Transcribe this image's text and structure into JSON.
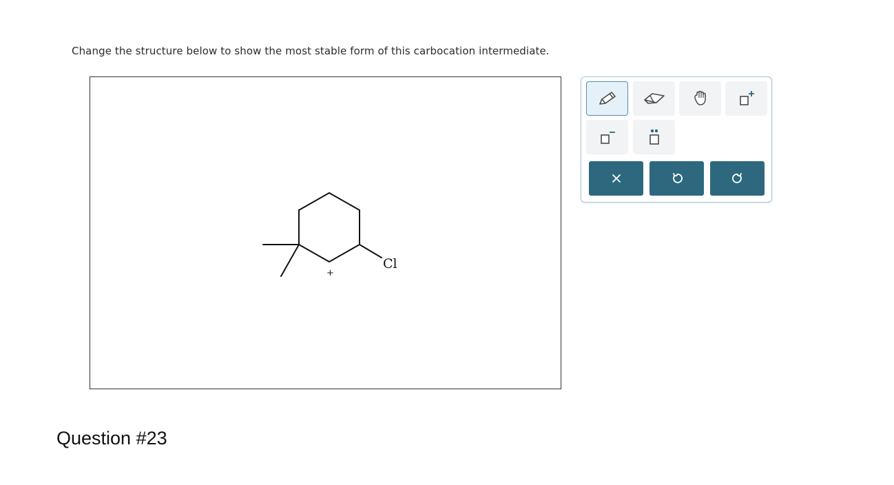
{
  "instruction": "Change the structure below to show the most stable form of this carbocation intermediate.",
  "molecule": {
    "charge_label": "+",
    "substituent_label": "Cl"
  },
  "toolbar": {
    "tools": [
      {
        "name": "pencil-tool",
        "icon": "pencil-icon",
        "active": true
      },
      {
        "name": "eraser-tool",
        "icon": "eraser-icon",
        "active": false
      },
      {
        "name": "hand-tool",
        "icon": "hand-icon",
        "active": false
      },
      {
        "name": "positive-charge-tool",
        "icon": "positive-charge-icon",
        "active": false
      },
      {
        "name": "negative-charge-tool",
        "icon": "negative-charge-icon",
        "active": false
      },
      {
        "name": "lone-pair-tool",
        "icon": "lone-pair-icon",
        "active": false
      }
    ],
    "actions": [
      {
        "name": "clear-button",
        "icon": "close-icon"
      },
      {
        "name": "undo-button",
        "icon": "undo-icon"
      },
      {
        "name": "redo-button",
        "icon": "redo-icon"
      }
    ],
    "accent_color": "#2d687f",
    "active_tool_bg": "#e4f1f8"
  },
  "question_label": "Question #23"
}
